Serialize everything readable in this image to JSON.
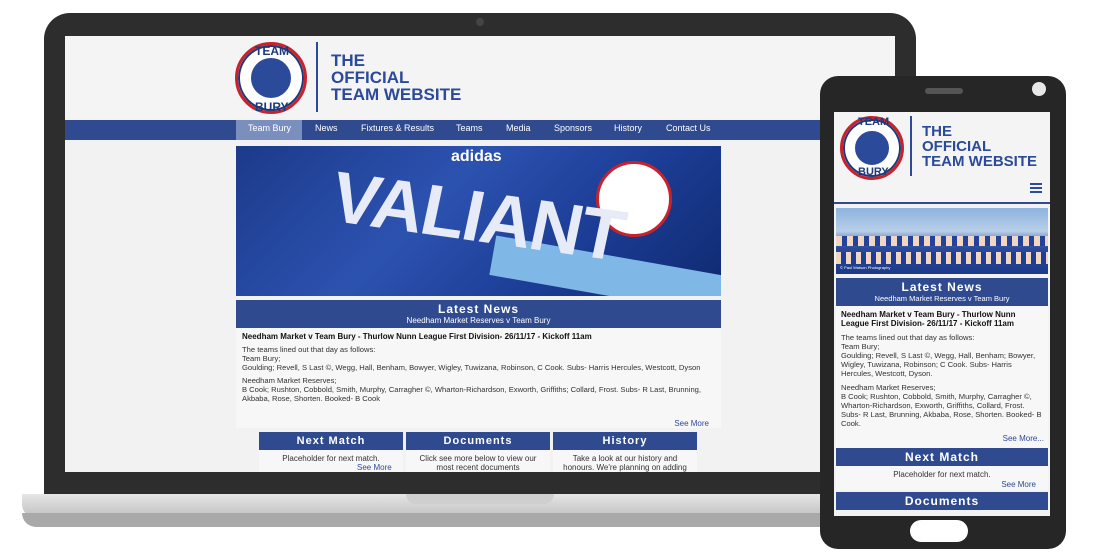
{
  "site": {
    "logo_top": "TEAM",
    "logo_bottom": "BURY",
    "title_lines": [
      "THE",
      "OFFICIAL",
      "TEAM WEBSITE"
    ]
  },
  "nav": {
    "items": [
      "Team Bury",
      "News",
      "Fixtures & Results",
      "Teams",
      "Media",
      "Sponsors",
      "History",
      "Contact Us"
    ],
    "active": "Team Bury"
  },
  "hero": {
    "brand": "adidas",
    "word": "VALIANT"
  },
  "latest_news": {
    "heading": "Latest News",
    "subheading": "Needham Market Reserves v Team Bury",
    "headline": "Needham Market v Team Bury - Thurlow Nunn League First Division- 26/11/17 - Kickoff 11am",
    "intro": "The teams lined out that day as follows:",
    "team1_label": "Team Bury;",
    "team1_desktop": "Goulding; Revell, S Last ©, Wegg, Hall, Benham, Bowyer, Wigley, Tuwizana, Robinson, C Cook. Subs- Harris Hercules, Westcott, Dyson",
    "team2_label": "Needham Market Reserves;",
    "team2_desktop": "B Cook; Rushton, Cobbold, Smith, Murphy, Carragher ©, Wharton-Richardson, Exworth, Griffiths; Collard, Frost. Subs- R Last, Brunning, Akbaba, Rose, Shorten. Booked- B Cook",
    "see_more": "See More"
  },
  "boxes": [
    {
      "title": "Next Match",
      "text": "Placeholder for next match.",
      "link": "See More"
    },
    {
      "title": "Documents",
      "text": "Click see more below to view our most recent documents",
      "link": ""
    },
    {
      "title": "History",
      "text": "Take a look at our history and honours. We're planning on adding to",
      "link": ""
    }
  ],
  "mobile": {
    "photo_credit": "© Paul Watson Photography",
    "team1_mobile": "Goulding; Revell, S Last ©, Wegg, Hall, Benham; Bowyer, Wigley, Tuwizana, Robinson; C Cook. Subs- Harris Hercules, Westcott, Dyson.",
    "team2_mobile": "B Cook; Rushton, Cobbold, Smith, Murphy, Carragher ©, Wharton-Richardson, Exworth, Griffiths, Collard, Frost. Subs- R Last, Brunning, Akbaba, Rose, Shorten. Booked- B Cook.",
    "see_more": "See More...",
    "next_match_title": "Next Match",
    "next_match_text": "Placeholder for next match.",
    "next_match_link": "See More",
    "documents_title": "Documents"
  },
  "colors": {
    "brand_blue": "#2f4a8f",
    "accent_red": "#c8232c"
  }
}
